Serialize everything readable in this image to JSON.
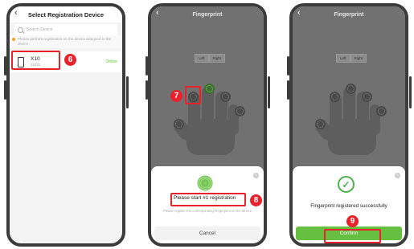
{
  "screen1": {
    "title": "Select Registration Device",
    "search_placeholder": "Search Device",
    "notice": "Please perform registration on the device assigned to the device",
    "device": {
      "name": "X10",
      "serial": "11032",
      "status": "Online"
    },
    "step": "6"
  },
  "screen2": {
    "title": "Fingerprint",
    "left_label": "Left",
    "right_label": "Right",
    "step_finger": "7",
    "sheet": {
      "prompt": "Please start #1 registration",
      "hint": "Please register the corresponding Fingerprint on the device",
      "cancel": "Cancel"
    },
    "step_prompt": "8"
  },
  "screen3": {
    "title": "Fingerprint",
    "left_label": "Left",
    "right_label": "Right",
    "sheet": {
      "message": "Fingerprint registered successfully",
      "confirm": "Confirm"
    },
    "step": "9"
  },
  "colors": {
    "accent": "#67bf42",
    "highlight": "#e8222b",
    "online": "#67c23a"
  }
}
